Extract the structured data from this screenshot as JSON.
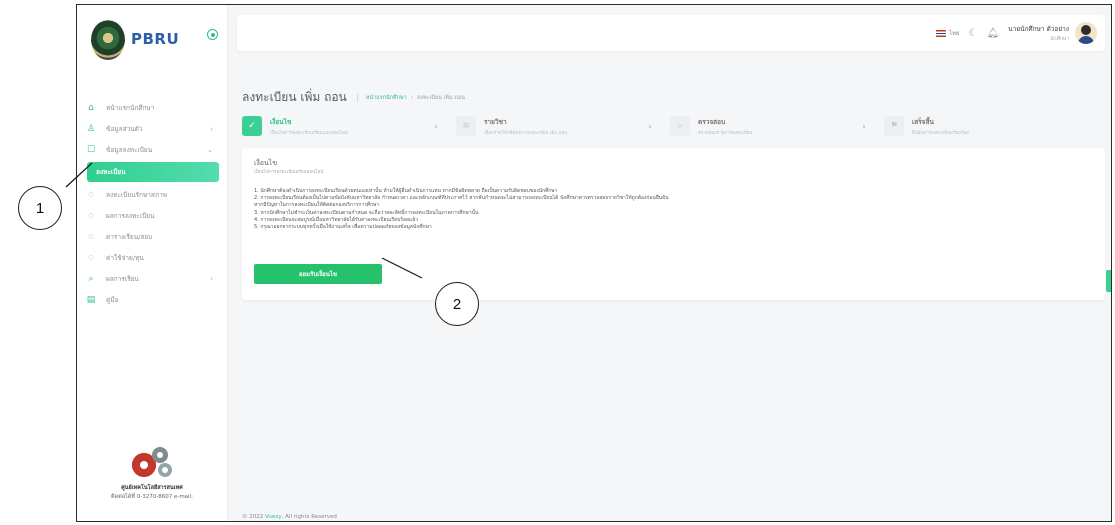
{
  "sidebar": {
    "logo_text": "PBRU",
    "items": [
      {
        "label": "หน้าแรกนักศึกษา",
        "icon": "home-icon",
        "type": "main"
      },
      {
        "label": "ข้อมูลส่วนตัว",
        "icon": "user-icon",
        "type": "main",
        "has_children": true
      },
      {
        "label": "ข้อมูลลงทะเบียน",
        "icon": "clipboard-icon",
        "type": "main",
        "has_children": true
      },
      {
        "label": "ลงทะเบียน",
        "icon": "dot-icon",
        "type": "active"
      },
      {
        "label": "ลงทะเบียนรักษาสภาพ",
        "icon": "dot-icon",
        "type": "sub"
      },
      {
        "label": "ผลการลงทะเบียน",
        "icon": "dot-icon",
        "type": "sub"
      },
      {
        "label": "ตารางเรียน/สอบ",
        "icon": "dot-icon",
        "type": "sub"
      },
      {
        "label": "ค่าใช้จ่าย/ทุน",
        "icon": "dot-icon",
        "type": "sub"
      },
      {
        "label": "ผลการเรียน",
        "icon": "search-icon",
        "type": "main",
        "has_children": true
      },
      {
        "label": "คู่มือ",
        "icon": "document-icon",
        "type": "main"
      }
    ],
    "footer_org": "ศูนย์เทคโนโลยีสารสนเทศ",
    "footer_contact": "ติดต่อได้ที่ 0-3270-8607 e-mail:"
  },
  "topbar": {
    "language": "ไทย",
    "user_name": "นายนักศึกษา ตัวอย่าง",
    "user_role": "นักศึกษา"
  },
  "page": {
    "title": "ลงทะเบียน เพิ่ม ถอน",
    "breadcrumb": [
      "หน้าแรกนักศึกษา",
      "ลงทะเบียน เพิ่ม ถอน"
    ]
  },
  "steps": [
    {
      "title": "เงื่อนไข",
      "desc": "เงื่อนไขการลงทะเบียนเรียนแบบออนไลน์",
      "icon": "check-icon",
      "active": true
    },
    {
      "title": "รายวิชา",
      "desc": "เลือกรายวิชาที่ต้องการลงทะเบียน เพิ่ม ถอน",
      "icon": "list-icon",
      "active": false
    },
    {
      "title": "ตรวจสอบ",
      "desc": "ตรวจสอบรายการลงทะเบียน",
      "icon": "search-icon",
      "active": false
    },
    {
      "title": "เสร็จสิ้น",
      "desc": "ยืนยันการลงทะเบียนเรียบร้อย",
      "icon": "flag-icon",
      "active": false
    }
  ],
  "card": {
    "title": "เงื่อนไข",
    "subtitle": "เงื่อนไขการลงทะเบียนเรียนออนไลน์",
    "conditions": [
      "1. นักศึกษาต้องดำเนินการลงทะเบียนเรียนด้วยตนเองเท่านั้น ห้ามให้ผู้อื่นดำเนินการแทน หากมีข้อผิดพลาด ถือเป็นความรับผิดชอบของนักศึกษา",
      "2. การลงทะเบียนเรียนต้องเป็นไปตามข้อบังคับมหาวิทยาลัย กำหนดเวลา และหลักเกณฑ์ที่ประกาศไว้ หากพ้นกำหนดจะไม่สามารถลงทะเบียนได้ นักศึกษาควรตรวจสอบรายวิชาให้ถูกต้องก่อนยืนยัน",
      "   หากมีปัญหาในการลงทะเบียนให้ติดต่อกองบริการการศึกษา",
      "3. หากนักศึกษาไม่ชำระเงินค่าลงทะเบียนตามกำหนด จะถือว่าสละสิทธิ์การลงทะเบียนในภาคการศึกษานั้น",
      "4. การลงทะเบียนจะสมบูรณ์เมื่อมหาวิทยาลัยได้รับค่าลงทะเบียนเรียบร้อยแล้ว",
      "5. กรุณาออกจากระบบทุกครั้งเมื่อใช้งานเสร็จ เพื่อความปลอดภัยของข้อมูลนักศึกษา"
    ],
    "accept_label": "ยอมรับเงื่อนไข"
  },
  "copyright": {
    "prefix": "© 2022",
    "brand": "Vuexy",
    "suffix": ", All rights Reserved"
  },
  "callouts": [
    "1",
    "2"
  ]
}
